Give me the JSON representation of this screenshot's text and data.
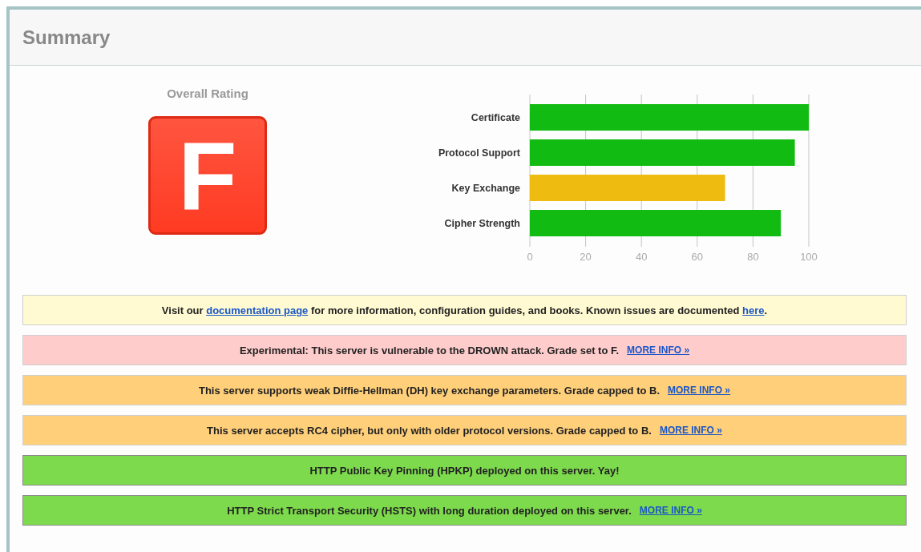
{
  "title": "Summary",
  "overall_rating": {
    "label": "Overall Rating",
    "grade": "F",
    "color": "#ff3b22"
  },
  "chart_data": {
    "type": "bar",
    "orientation": "horizontal",
    "categories": [
      "Certificate",
      "Protocol Support",
      "Key Exchange",
      "Cipher Strength"
    ],
    "series": [
      {
        "color": "#11bb11",
        "values": [
          100,
          95,
          null,
          90
        ]
      },
      {
        "color": "#eebb11",
        "values": [
          null,
          null,
          70,
          null
        ]
      }
    ],
    "grid": true,
    "xlim": [
      0,
      100
    ],
    "xticks": [
      0,
      20,
      40,
      60,
      80,
      100
    ]
  },
  "notices": [
    {
      "kind": "info",
      "parts": [
        {
          "text": "Visit our ",
          "link": false
        },
        {
          "text": "documentation page",
          "link": true
        },
        {
          "text": " for more information, configuration guides, and books. Known issues are documented ",
          "link": false
        },
        {
          "text": "here",
          "link": true
        },
        {
          "text": ".",
          "link": false
        }
      ]
    },
    {
      "kind": "error",
      "parts": [
        {
          "text": "Experimental: This server is vulnerable to the DROWN attack. Grade set to F.",
          "link": false
        }
      ],
      "more_info": "MORE INFO »"
    },
    {
      "kind": "warning",
      "parts": [
        {
          "text": "This server supports weak Diffie-Hellman (DH) key exchange parameters. Grade capped to B.",
          "link": false
        }
      ],
      "more_info": "MORE INFO »"
    },
    {
      "kind": "warning",
      "parts": [
        {
          "text": "This server accepts RC4 cipher, but only with older protocol versions. Grade capped to B.",
          "link": false
        }
      ],
      "more_info": "MORE INFO »"
    },
    {
      "kind": "success",
      "parts": [
        {
          "text": "HTTP Public Key Pinning (HPKP) deployed on this server. Yay!",
          "link": false
        }
      ]
    },
    {
      "kind": "success",
      "parts": [
        {
          "text": "HTTP Strict Transport Security (HSTS) with long duration deployed on this server.",
          "link": false
        }
      ],
      "more_info": "MORE INFO »"
    }
  ]
}
